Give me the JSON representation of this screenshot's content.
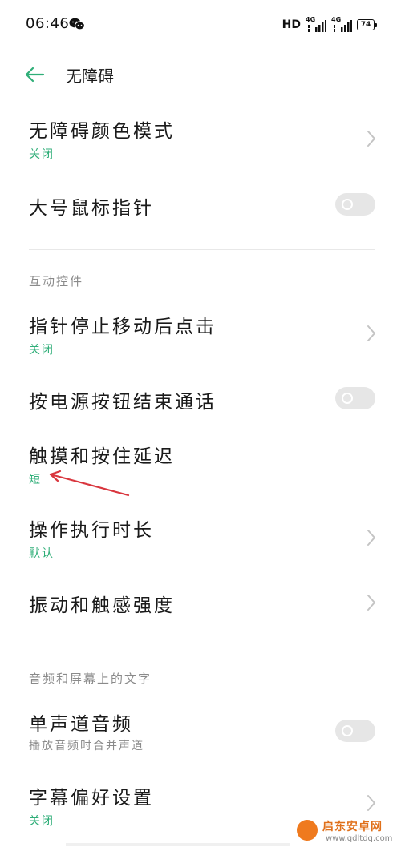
{
  "status_bar": {
    "time": "06:46",
    "network_label": "HD",
    "signal1_label": "4G",
    "signal2_label": "4G",
    "battery": "74",
    "icons": [
      "wechat-icon",
      "signal-icon",
      "battery-icon"
    ]
  },
  "header": {
    "title": "无障碍",
    "back_icon": "arrow-left-icon"
  },
  "items": {
    "color_mode": {
      "title": "无障碍颜色模式",
      "value": "关闭"
    },
    "large_pointer": {
      "title": "大号鼠标指针",
      "toggle": false
    },
    "section_interaction": "互动控件",
    "dwell_click": {
      "title": "指针停止移动后点击",
      "value": "关闭"
    },
    "power_end_call": {
      "title": "按电源按钮结束通话",
      "toggle": false
    },
    "touch_hold_delay": {
      "title": "触摸和按住延迟",
      "value": "短"
    },
    "action_time": {
      "title": "操作执行时长",
      "value": "默认"
    },
    "vibration": {
      "title": "振动和触感强度"
    },
    "section_audio": "音频和屏幕上的文字",
    "mono_audio": {
      "title": "单声道音频",
      "subtitle": "播放音频时合并声道",
      "toggle": false
    },
    "caption_prefs": {
      "title": "字幕偏好设置",
      "value": "关闭"
    }
  },
  "colors": {
    "accent": "#2fae78",
    "annotation": "#d9363e",
    "secondary_text": "#8a8a8a",
    "toggle_off": "#e6e6e6"
  },
  "watermark": {
    "name": "启东安卓网",
    "url": "www.qdltdq.com"
  }
}
